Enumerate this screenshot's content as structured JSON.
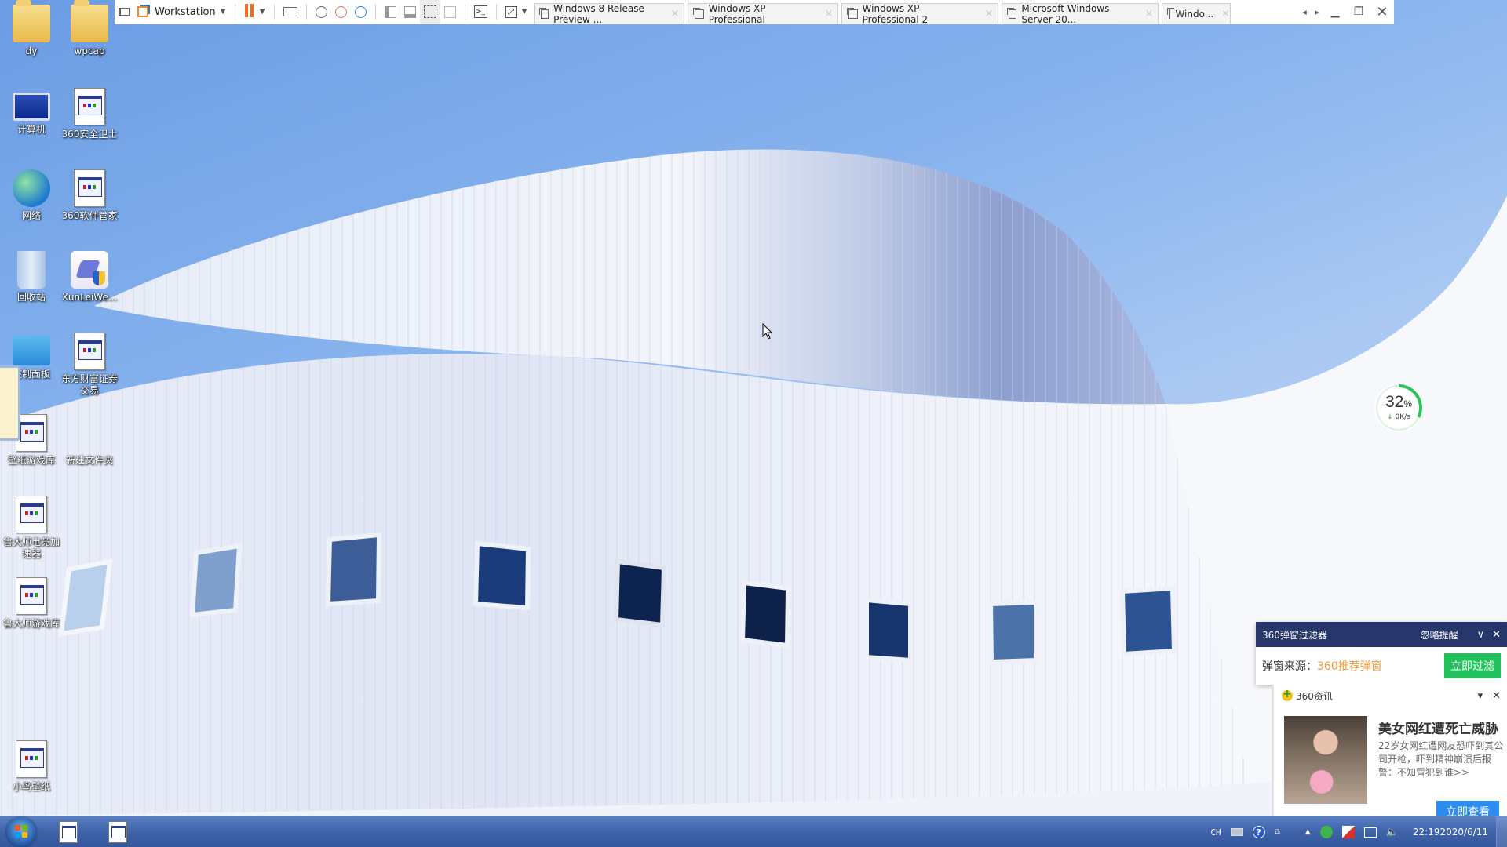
{
  "vm_toolbar": {
    "product_label": "Workstation",
    "tabs": [
      {
        "label": "Windows 8 Release Preview ..."
      },
      {
        "label": "Windows XP Professional"
      },
      {
        "label": "Windows XP Professional 2"
      },
      {
        "label": "Microsoft Windows Server 20..."
      },
      {
        "label": "Windo..."
      }
    ],
    "icons": {
      "pin": "pin-icon",
      "logo": "vmware-logo-icon",
      "pause": "pause-icon",
      "send_keys": "send-ctrl-alt-del-icon",
      "snapshot": "snapshot-icon",
      "revert": "revert-snapshot-icon",
      "manage": "snapshot-manager-icon",
      "library": "library-view-icon",
      "thumbnail": "thumbnail-bar-icon",
      "fullscreen": "full-screen-icon",
      "unity": "unity-icon",
      "console": "console-view-icon",
      "stretch": "stretch-guest-icon"
    },
    "close_glyph": "×",
    "nav_left": "◂",
    "nav_right": "▸",
    "minimize_glyph": "▁",
    "restore_glyph": "❐",
    "close_window_glyph": "✕"
  },
  "desktop_icons": [
    {
      "label": "dy",
      "type": "folder"
    },
    {
      "label": "wpcap",
      "type": "folder"
    },
    {
      "label": "计算机",
      "type": "computer"
    },
    {
      "label": "360安全卫士",
      "type": "file"
    },
    {
      "label": "网络",
      "type": "network"
    },
    {
      "label": "360软件管家",
      "type": "file"
    },
    {
      "label": "回收站",
      "type": "bin"
    },
    {
      "label": "XunLeiWe...",
      "type": "xunlei"
    },
    {
      "label": "控制面板",
      "type": "panel"
    },
    {
      "label": "东方财富证券交易",
      "type": "file"
    },
    {
      "label": "壁纸游戏库",
      "type": "file"
    },
    {
      "label": "新建文件夹",
      "type": "none"
    },
    {
      "label": "鲁大师电竞加速器",
      "type": "file"
    },
    {
      "label": "鲁大师游戏库",
      "type": "file"
    },
    {
      "label": "小鸟壁纸",
      "type": "file"
    }
  ],
  "speed_widget": {
    "percent": 32,
    "percent_label": "32",
    "percent_unit": "%",
    "arrow": "↓",
    "rate": "0K/s",
    "accent": "#2fc25b"
  },
  "popup_filter": {
    "title": "360弹窗过滤器",
    "ignore_label": "忽略提醒",
    "collapse_glyph": "∨",
    "close_glyph": "✕",
    "source_label": "弹窗来源：",
    "source_value": "360推荐弹窗",
    "filter_button": "立即过滤",
    "header_color": "#27366b",
    "button_color": "#22c05a"
  },
  "news_popup": {
    "brand": "360资讯",
    "menu_glyph": "▾",
    "close_glyph": "✕",
    "headline": "美女网红遭死亡威胁",
    "description": "22岁女网红遭网友恐吓到其公司开枪，吓到精神崩溃后报警：不知冒犯到谁>>",
    "view_button": "立即查看",
    "button_color": "#2d8cf0"
  },
  "taskbar": {
    "start_label": "Start",
    "tray": {
      "lang": "CH",
      "help_glyph": "?",
      "expand_glyph": "▲",
      "time": "22:19",
      "date": "2020/6/11"
    }
  }
}
